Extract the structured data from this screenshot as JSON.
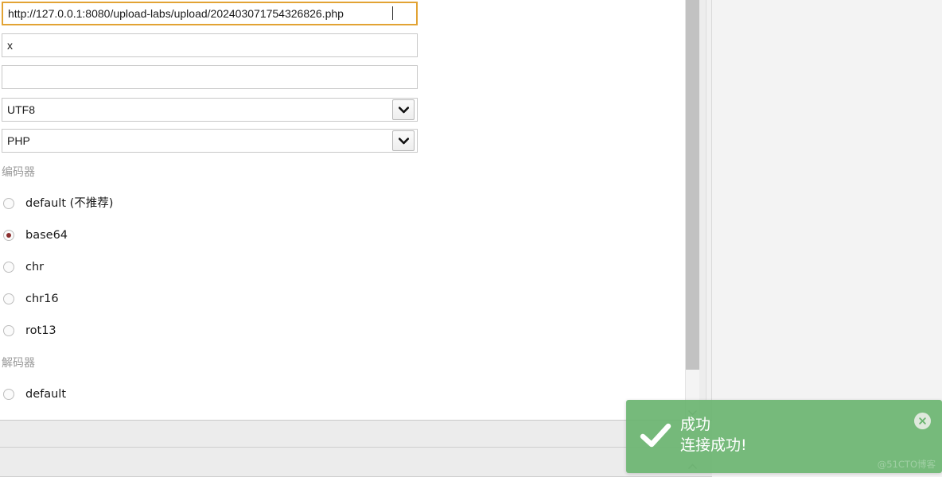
{
  "form": {
    "url_field": {
      "value": "http://127.0.0.1:8080/upload-labs/upload/202403071754326826.php",
      "placeholder": ""
    },
    "password_field": {
      "value": "x",
      "placeholder": ""
    },
    "extra_field": {
      "value": "",
      "placeholder": ""
    },
    "charset_select": {
      "value": "UTF8",
      "options": [
        "UTF8"
      ]
    },
    "script_select": {
      "value": "PHP",
      "options": [
        "PHP"
      ]
    },
    "encoder": {
      "label": "编码器",
      "selected": "base64",
      "options": [
        {
          "value": "default",
          "label": "default (不推荐)",
          "checked": false
        },
        {
          "value": "base64",
          "label": "base64",
          "checked": true
        },
        {
          "value": "chr",
          "label": "chr",
          "checked": false
        },
        {
          "value": "chr16",
          "label": "chr16",
          "checked": false
        },
        {
          "value": "rot13",
          "label": "rot13",
          "checked": false
        }
      ]
    },
    "decoder": {
      "label": "解码器",
      "selected": "",
      "options": [
        {
          "value": "default",
          "label": "default",
          "checked": false
        }
      ]
    }
  },
  "toast": {
    "title": "成功",
    "message": "连接成功!",
    "close_label": "×",
    "check_icon": "check-icon",
    "close_icon": "close-icon",
    "background_color": "#6cb571",
    "text_color": "#ffffff"
  },
  "watermark": {
    "text": "@51CTO博客"
  },
  "icons": {
    "chevron_down": "chevron-down-icon",
    "scroll_up": "scroll-up-arrow-icon",
    "scroll_down": "scroll-down-arrow-icon"
  },
  "colors": {
    "focus_border": "#e2a334",
    "radio_dot": "#8b2f2f",
    "scrollbar_thumb": "#c2c2c2",
    "panel_background": "#f3f3f3"
  }
}
